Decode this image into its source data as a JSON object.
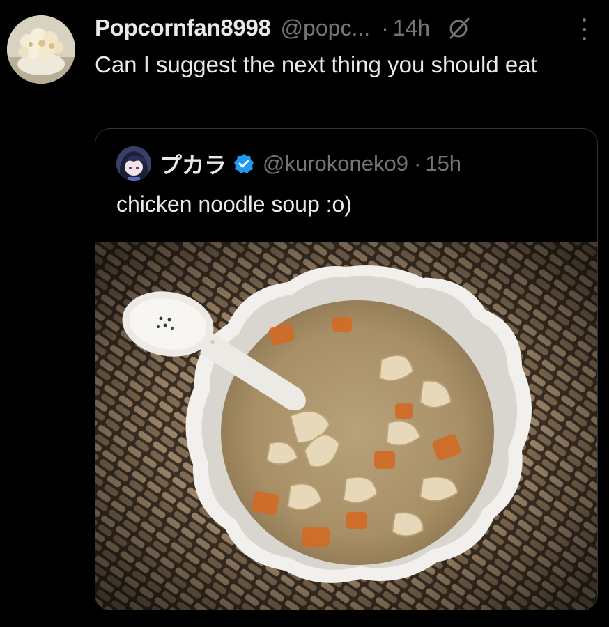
{
  "tweet": {
    "display_name": "Popcornfan8998",
    "handle": "@popc...",
    "separator": "·",
    "timestamp": "14h",
    "text": "Can I suggest the next thing you should eat",
    "avatar_icon": "popcorn-avatar",
    "grok_icon": "grok-icon",
    "more_icon": "more-icon"
  },
  "quote": {
    "display_name": "プカラ",
    "verified_icon": "verified-badge-icon",
    "handle": "@kurokoneko9",
    "separator": "·",
    "timestamp": "15h",
    "text": "chicken noodle soup :o)",
    "media_icon": "chicken-noodle-soup-photo"
  },
  "colors": {
    "background": "#000000",
    "primary_text": "#e7e9ea",
    "secondary_text": "#71767b",
    "border": "#2f3336",
    "verified": "#1d9bf0"
  }
}
